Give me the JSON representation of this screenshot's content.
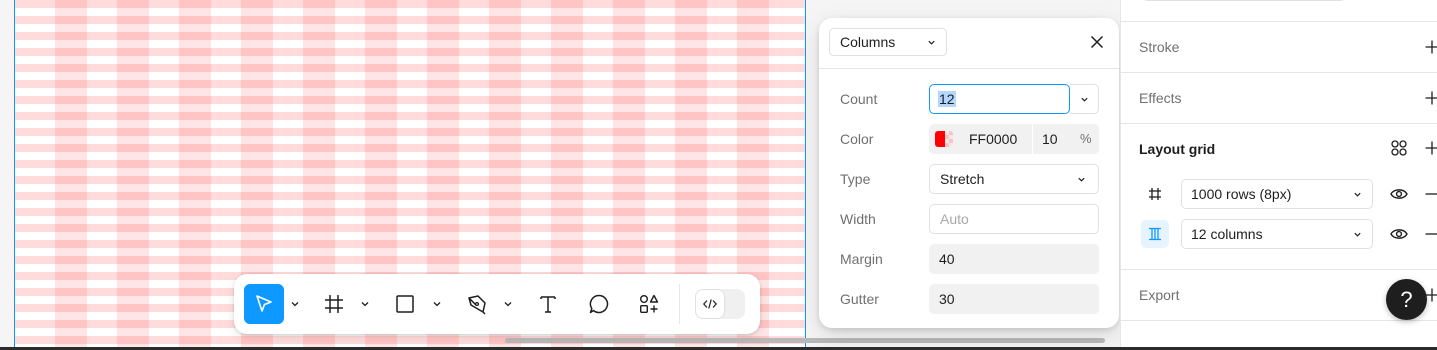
{
  "canvas": {
    "grid_color": "#FF0000",
    "column_count": 12
  },
  "toolbar": {
    "tools": [
      {
        "name": "move-tool",
        "icon": "cursor-arrow-icon",
        "active": true
      },
      {
        "name": "frame-tool",
        "icon": "hash-frame-icon"
      },
      {
        "name": "shape-tool",
        "icon": "square-icon"
      },
      {
        "name": "pen-tool",
        "icon": "pen-nib-icon"
      },
      {
        "name": "text-tool",
        "icon": "text-t-icon"
      },
      {
        "name": "comment-tool",
        "icon": "speech-bubble-icon"
      },
      {
        "name": "actions-tool",
        "icon": "shapes-plus-icon"
      }
    ],
    "dev_mode_icon": "code-brackets-icon",
    "accent": "#0D99FF"
  },
  "popover": {
    "grid_type": "Columns",
    "labels": {
      "count": "Count",
      "color": "Color",
      "type": "Type",
      "width": "Width",
      "margin": "Margin",
      "gutter": "Gutter"
    },
    "count_value": "12",
    "color_hex": "FF0000",
    "color_swatch": "#FF0000",
    "opacity": "10",
    "opacity_unit": "%",
    "type_value": "Stretch",
    "width_placeholder": "Auto",
    "margin_value": "40",
    "gutter_value": "30"
  },
  "right_panel": {
    "sections": {
      "stroke": "Stroke",
      "effects": "Effects",
      "layout_grid": "Layout grid",
      "export": "Export"
    },
    "grids": [
      {
        "label": "1000 rows (8px)",
        "icon": "rows-grid-icon"
      },
      {
        "label": "12 columns",
        "icon": "columns-grid-icon"
      }
    ]
  },
  "help": {
    "label": "?"
  }
}
